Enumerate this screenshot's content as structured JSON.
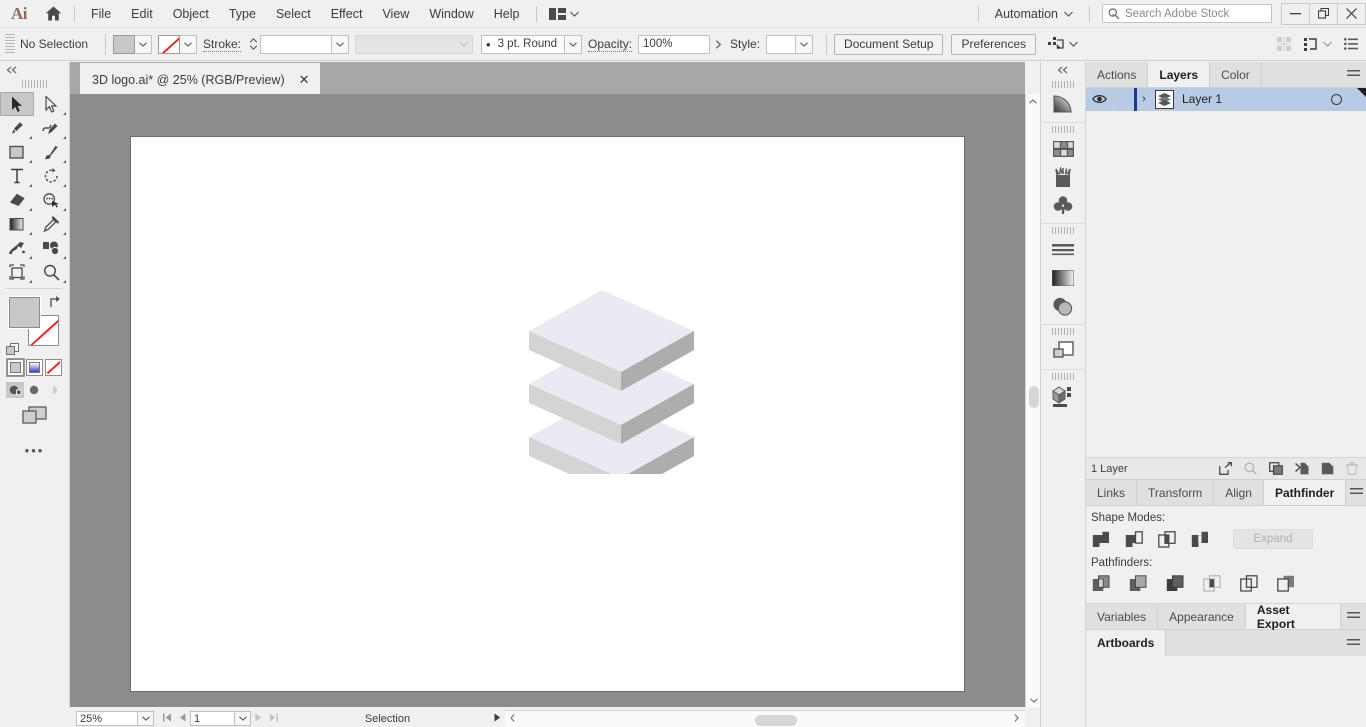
{
  "app": {
    "name": "Adobe Illustrator",
    "logo_text": "Ai"
  },
  "menubar": {
    "items": [
      "File",
      "Edit",
      "Object",
      "Type",
      "Select",
      "Effect",
      "View",
      "Window",
      "Help"
    ],
    "automation_label": "Automation",
    "search_placeholder": "Search Adobe Stock"
  },
  "controlbar": {
    "selection_state": "No Selection",
    "stroke_label": "Stroke:",
    "stroke_weight": "",
    "profile_value": "",
    "brush_value": "3 pt. Round",
    "opacity_label": "Opacity:",
    "opacity_value": "100%",
    "style_label": "Style:",
    "style_value": "",
    "document_setup_label": "Document Setup",
    "preferences_label": "Preferences"
  },
  "toolbar": {
    "tools": [
      {
        "name": "selection-tool",
        "glyph": "selection",
        "active": true
      },
      {
        "name": "direct-selection-tool",
        "glyph": "direct-selection",
        "active": false
      },
      {
        "name": "pen-tool",
        "glyph": "pen",
        "active": false
      },
      {
        "name": "curvature-tool",
        "glyph": "curvature",
        "active": false
      },
      {
        "name": "rectangle-tool",
        "glyph": "rectangle",
        "active": false
      },
      {
        "name": "paintbrush-tool",
        "glyph": "paintbrush",
        "active": false
      },
      {
        "name": "type-tool",
        "glyph": "type",
        "active": false
      },
      {
        "name": "rotate-tool",
        "glyph": "rotate",
        "active": false
      },
      {
        "name": "eraser-tool",
        "glyph": "eraser",
        "active": false
      },
      {
        "name": "shape-builder-tool",
        "glyph": "shape-builder",
        "active": false
      },
      {
        "name": "gradient-tool",
        "glyph": "gradient",
        "active": false
      },
      {
        "name": "eyedropper-tool",
        "glyph": "eyedropper",
        "active": false
      },
      {
        "name": "symbol-sprayer-tool",
        "glyph": "symbol-sprayer",
        "active": false
      },
      {
        "name": "graph-tool",
        "glyph": "graph",
        "active": false
      },
      {
        "name": "artboard-tool",
        "glyph": "artboard",
        "active": false
      },
      {
        "name": "zoom-tool",
        "glyph": "zoom",
        "active": false
      }
    ],
    "fill_color": "#c8c8c8",
    "stroke_color": "#ffffff",
    "none_color": "#e8262b",
    "more_tools_label": "•••"
  },
  "document": {
    "tab_title": "3D logo.ai* @ 25% (RGB/Preview)",
    "close_label": "✕"
  },
  "artwork": {
    "description": "3D isometric stacked slabs logo",
    "top_face_color": "#eaebf2",
    "left_face_color": "#d4d4d4",
    "right_face_color": "#adadad",
    "slab_count": 3
  },
  "statusbar": {
    "zoom_level": "25%",
    "page_number": "1",
    "mode": "Selection"
  },
  "iconrail": {
    "icons": [
      {
        "name": "gradient-panel-icon"
      },
      {
        "name": "swatches-panel-icon"
      },
      {
        "name": "brushes-panel-icon"
      },
      {
        "name": "symbols-panel-icon"
      },
      {
        "name": "stroke-panel-icon"
      },
      {
        "name": "gradient2-panel-icon"
      },
      {
        "name": "transparency-panel-icon"
      },
      {
        "name": "layers-alt-panel-icon"
      },
      {
        "name": "three-d-panel-icon"
      }
    ]
  },
  "panels": {
    "top_group": {
      "tabs": [
        {
          "label": "Actions",
          "active": false
        },
        {
          "label": "Layers",
          "active": true
        },
        {
          "label": "Color",
          "active": false
        }
      ],
      "layers": [
        {
          "name": "Layer 1",
          "visible": true,
          "selected": true,
          "locked": false
        }
      ],
      "footer_count": "1 Layer",
      "footer_icons": [
        {
          "name": "release-to-layers-icon"
        },
        {
          "name": "locate-object-icon"
        },
        {
          "name": "make-clipping-mask-icon"
        },
        {
          "name": "create-new-sublayer-icon"
        },
        {
          "name": "create-new-layer-icon"
        },
        {
          "name": "delete-selection-icon"
        }
      ]
    },
    "middle_group": {
      "tabs": [
        {
          "label": "Links",
          "active": false
        },
        {
          "label": "Transform",
          "active": false
        },
        {
          "label": "Align",
          "active": false
        },
        {
          "label": "Pathfinder",
          "active": true
        }
      ],
      "shape_modes_label": "Shape Modes:",
      "shape_modes": [
        {
          "name": "unite-button"
        },
        {
          "name": "minus-front-button"
        },
        {
          "name": "intersect-button"
        },
        {
          "name": "exclude-button"
        }
      ],
      "expand_label": "Expand",
      "pathfinders_label": "Pathfinders:",
      "pathfinders": [
        {
          "name": "divide-button"
        },
        {
          "name": "trim-button"
        },
        {
          "name": "merge-button"
        },
        {
          "name": "crop-button"
        },
        {
          "name": "outline-button"
        },
        {
          "name": "minus-back-button"
        }
      ]
    },
    "bottom_group": {
      "tabs": [
        {
          "label": "Variables",
          "active": false
        },
        {
          "label": "Appearance",
          "active": false
        },
        {
          "label": "Asset Export",
          "active": true
        }
      ]
    },
    "artboards_group": {
      "tabs": [
        {
          "label": "Artboards",
          "active": true
        }
      ]
    }
  }
}
